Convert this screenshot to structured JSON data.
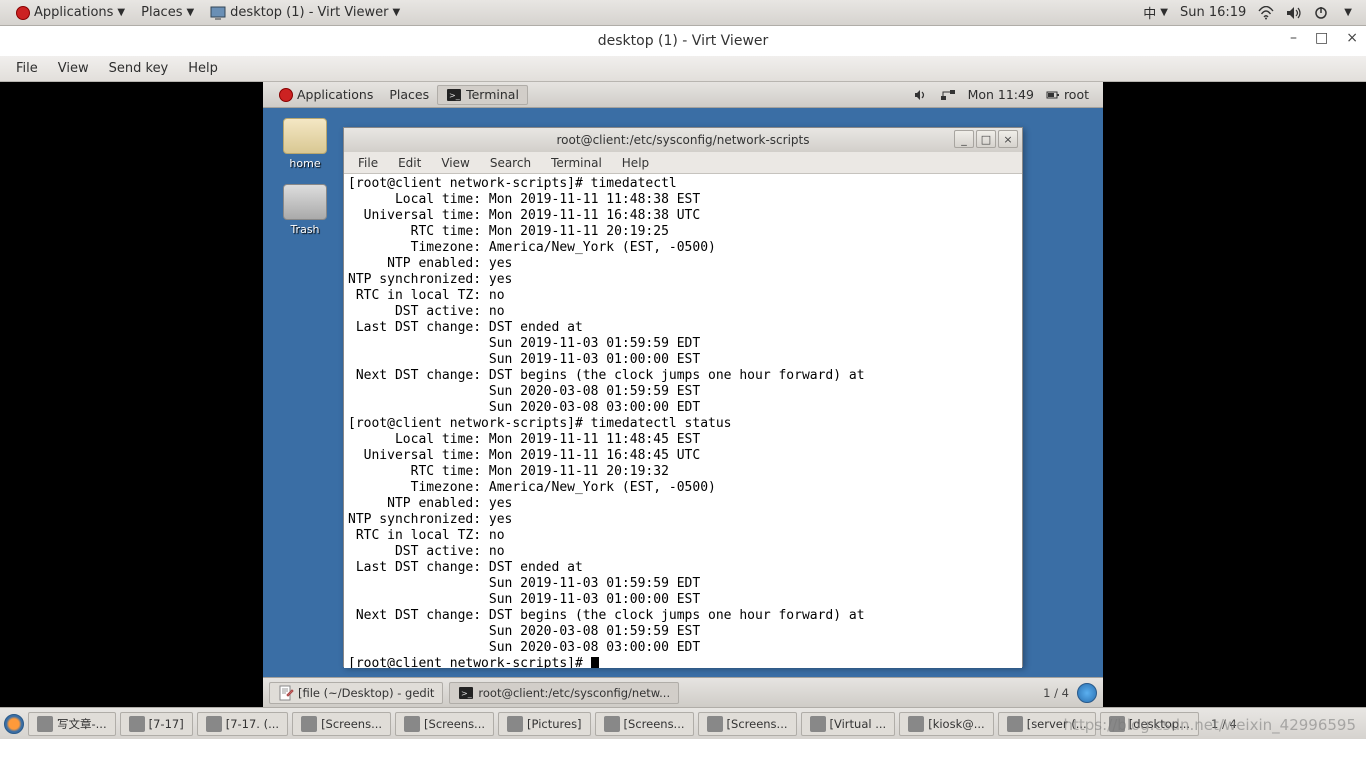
{
  "host": {
    "topbar": {
      "applications": "Applications",
      "places": "Places",
      "task_label": "desktop (1) - Virt Viewer",
      "input_method": "中",
      "clock": "Sun 16:19"
    },
    "virt_viewer": {
      "title": "desktop (1) - Virt Viewer",
      "menus": {
        "file": "File",
        "view": "View",
        "sendkey": "Send key",
        "help": "Help"
      }
    },
    "taskbar": {
      "items": [
        "写文章-...",
        "[7-17]",
        "[7-17. (...",
        "[Screens...",
        "[Screens...",
        "[Pictures]",
        "[Screens...",
        "[Screens...",
        "[Virtual ...",
        "[kiosk@...",
        "[server (...",
        "[desktop..."
      ],
      "right_label": "1 / 4"
    },
    "watermark": "https://blog.csdn.net/weixin_42996595"
  },
  "guest": {
    "topbar": {
      "applications": "Applications",
      "places": "Places",
      "terminal": "Terminal",
      "clock": "Mon 11:49",
      "user": "root"
    },
    "desktop": {
      "home_label": "home",
      "trash_label": "Trash"
    },
    "terminal": {
      "title": "root@client:/etc/sysconfig/network-scripts",
      "menus": {
        "file": "File",
        "edit": "Edit",
        "view": "View",
        "search": "Search",
        "terminal": "Terminal",
        "help": "Help"
      },
      "lines": [
        "[root@client network-scripts]# timedatectl",
        "      Local time: Mon 2019-11-11 11:48:38 EST",
        "  Universal time: Mon 2019-11-11 16:48:38 UTC",
        "        RTC time: Mon 2019-11-11 20:19:25",
        "        Timezone: America/New_York (EST, -0500)",
        "     NTP enabled: yes",
        "NTP synchronized: yes",
        " RTC in local TZ: no",
        "      DST active: no",
        " Last DST change: DST ended at",
        "                  Sun 2019-11-03 01:59:59 EDT",
        "                  Sun 2019-11-03 01:00:00 EST",
        " Next DST change: DST begins (the clock jumps one hour forward) at",
        "                  Sun 2020-03-08 01:59:59 EST",
        "                  Sun 2020-03-08 03:00:00 EDT",
        "[root@client network-scripts]# timedatectl status",
        "      Local time: Mon 2019-11-11 11:48:45 EST",
        "  Universal time: Mon 2019-11-11 16:48:45 UTC",
        "        RTC time: Mon 2019-11-11 20:19:32",
        "        Timezone: America/New_York (EST, -0500)",
        "     NTP enabled: yes",
        "NTP synchronized: yes",
        " RTC in local TZ: no",
        "      DST active: no",
        " Last DST change: DST ended at",
        "                  Sun 2019-11-03 01:59:59 EDT",
        "                  Sun 2019-11-03 01:00:00 EST",
        " Next DST change: DST begins (the clock jumps one hour forward) at",
        "                  Sun 2020-03-08 01:59:59 EST",
        "                  Sun 2020-03-08 03:00:00 EDT",
        "[root@client network-scripts]# "
      ]
    },
    "taskbar": {
      "items": [
        "[file (~/Desktop) - gedit",
        "root@client:/etc/sysconfig/netw..."
      ],
      "workspace": "1 / 4"
    }
  }
}
